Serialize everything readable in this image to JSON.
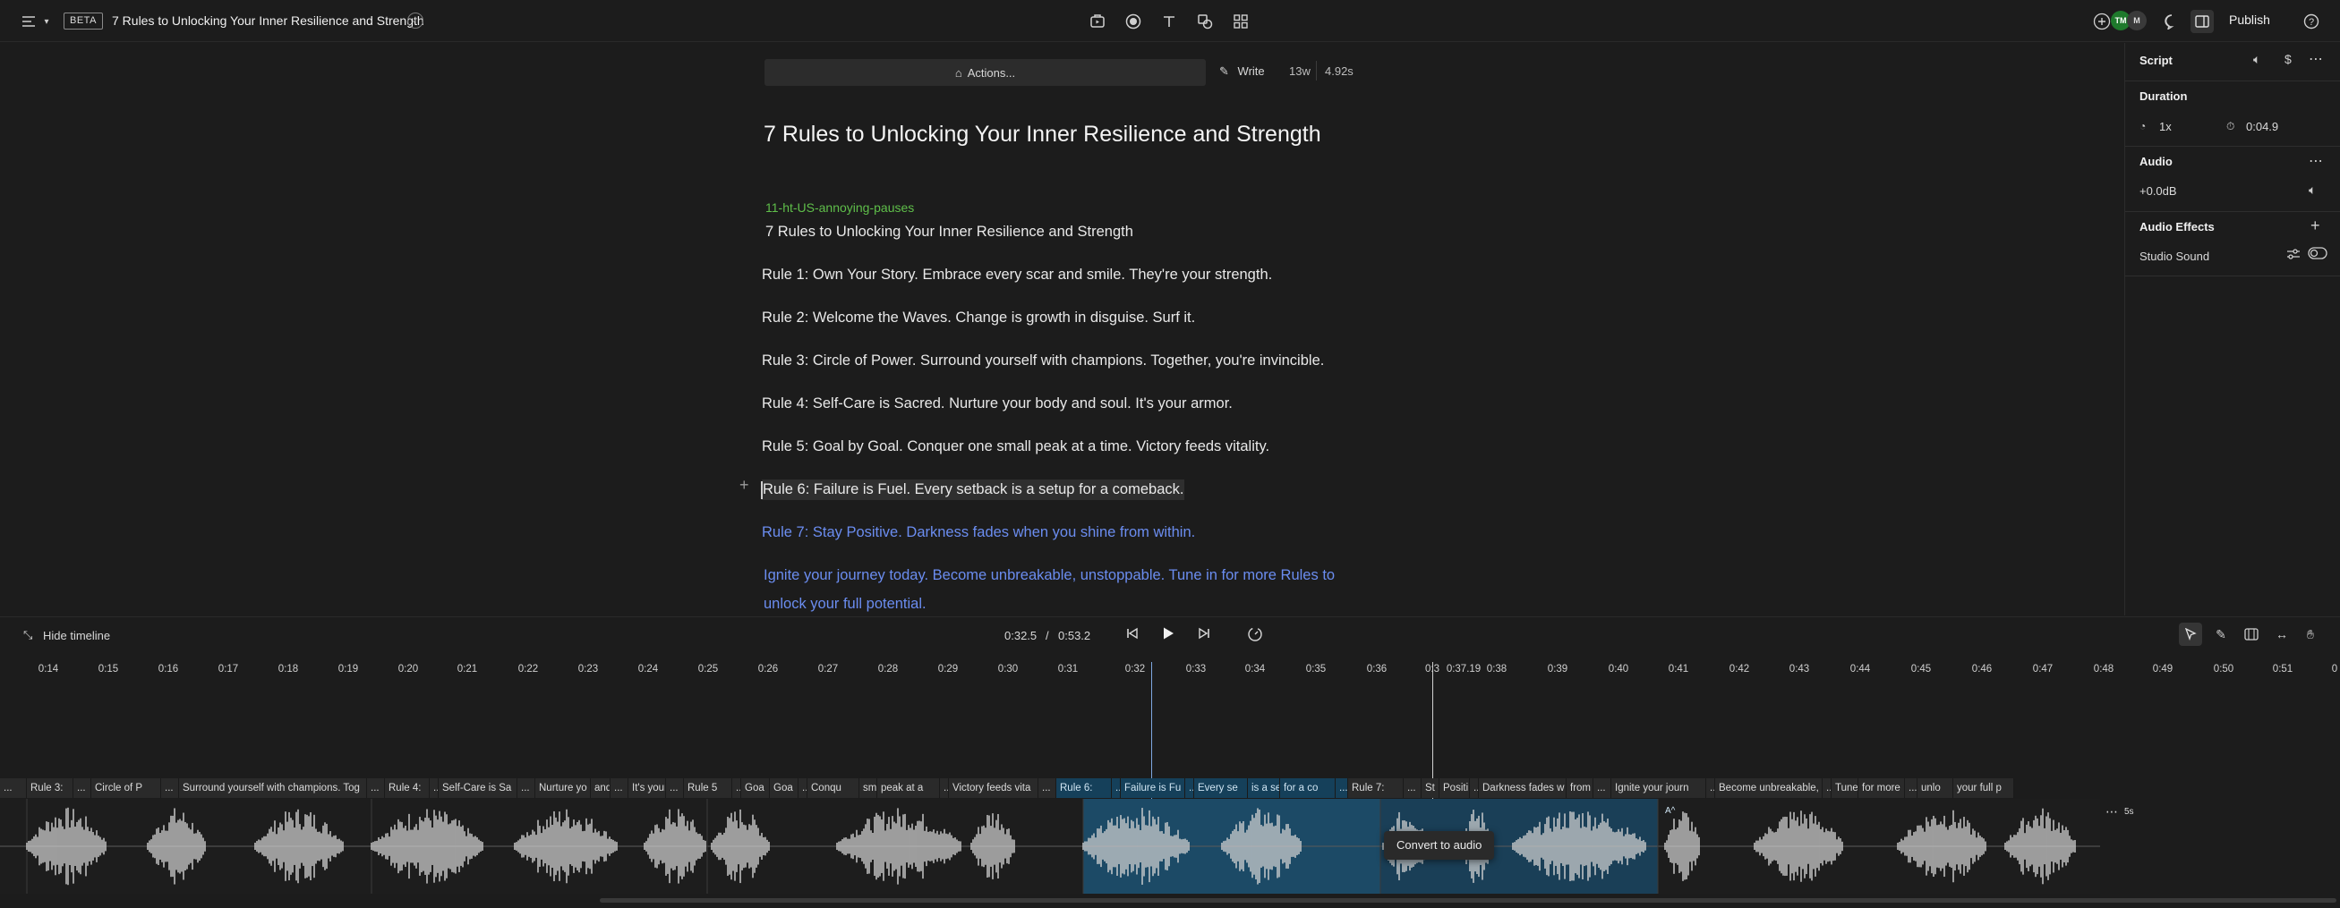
{
  "topbar": {
    "beta_label": "BETA",
    "doc_title": "7 Rules to Unlocking Your Inner Resilience and Strength",
    "publish_label": "Publish",
    "avatars": [
      "TM",
      "M"
    ]
  },
  "editor": {
    "actions_label": "Actions...",
    "write_label": "Write",
    "word_count": "13w",
    "duration": "4.92s",
    "heading": "7 Rules to Unlocking Your Inner Resilience and Strength",
    "speaker": "11-ht-US-annoying-pauses",
    "lines": [
      "7 Rules to Unlocking Your Inner Resilience and Strength",
      "Rule 1: Own Your Story. Embrace every scar and smile. They're your strength.",
      "Rule 2: Welcome the Waves. Change is growth in disguise. Surf it.",
      "Rule 3: Circle of Power. Surround yourself with champions. Together, you're invincible.",
      "Rule 4: Self-Care is Sacred. Nurture your body and soul. It's your armor.",
      "Rule 5: Goal by Goal. Conquer one small peak at a time. Victory feeds vitality.",
      "Rule 6: Failure is Fuel. Every setback is a setup for a comeback.",
      "Rule 7: Stay Positive. Darkness fades when you shine from within.",
      "Ignite your journey today. Become unbreakable, unstoppable. Tune in for more Rules to",
      "unlock your full potential."
    ]
  },
  "right_panel": {
    "script_title": "Script",
    "duration_title": "Duration",
    "speed": "1x",
    "clip_duration": "0:04.9",
    "audio_title": "Audio",
    "gain": "+0.0dB",
    "effects_title": "Audio Effects",
    "studio_sound": "Studio Sound"
  },
  "transport": {
    "hide_timeline": "Hide timeline",
    "current_time": "0:32.5",
    "separator": "/",
    "total_time": "0:53.2"
  },
  "ruler": {
    "ticks": [
      "0:14",
      "0:15",
      "0:16",
      "0:17",
      "0:18",
      "0:19",
      "0:20",
      "0:21",
      "0:22",
      "0:23",
      "0:24",
      "0:25",
      "0:26",
      "0:27",
      "0:28",
      "0:29",
      "0:30",
      "0:31",
      "0:32",
      "0:33",
      "0:34",
      "0:35",
      "0:36",
      "0:3",
      "0:37.19",
      "0:38",
      "0:39",
      "0:40",
      "0:41",
      "0:42",
      "0:43",
      "0:44",
      "0:45",
      "0:46",
      "0:47",
      "0:48",
      "0:49",
      "0:50",
      "0:51",
      "0"
    ]
  },
  "timeline": {
    "words": [
      {
        "t": "...",
        "hl": false
      },
      {
        "t": "Rule 3:",
        "hl": false
      },
      {
        "t": "...",
        "hl": false
      },
      {
        "t": "Circle of P",
        "hl": false
      },
      {
        "t": "...",
        "hl": false
      },
      {
        "t": "Surround yourself with champions. Tog",
        "hl": false
      },
      {
        "t": "...",
        "hl": false
      },
      {
        "t": "Rule 4:",
        "hl": false
      },
      {
        "t": "...",
        "hl": false
      },
      {
        "t": "Self-Care is Sa",
        "hl": false
      },
      {
        "t": "...",
        "hl": false
      },
      {
        "t": "Nurture yo",
        "hl": false
      },
      {
        "t": "and s",
        "hl": false
      },
      {
        "t": "...",
        "hl": false
      },
      {
        "t": "It's your",
        "hl": false
      },
      {
        "t": "...",
        "hl": false
      },
      {
        "t": "Rule 5",
        "hl": false
      },
      {
        "t": "...",
        "hl": false
      },
      {
        "t": "Goa",
        "hl": false
      },
      {
        "t": "Goa",
        "hl": false
      },
      {
        "t": "...",
        "hl": false
      },
      {
        "t": "Conqu",
        "hl": false
      },
      {
        "t": "sma",
        "hl": false
      },
      {
        "t": "peak at a",
        "hl": false
      },
      {
        "t": "...",
        "hl": false
      },
      {
        "t": "Victory feeds vita",
        "hl": false
      },
      {
        "t": "...",
        "hl": false
      },
      {
        "t": "Rule 6:",
        "hl": true
      },
      {
        "t": "...",
        "hl": true
      },
      {
        "t": "Failure is Fu",
        "hl": true
      },
      {
        "t": "...",
        "hl": true
      },
      {
        "t": "Every se",
        "hl": true
      },
      {
        "t": "is a se",
        "hl": true
      },
      {
        "t": "for a co",
        "hl": true
      },
      {
        "t": "...",
        "hl": true
      },
      {
        "t": "Rule 7:",
        "hl": false
      },
      {
        "t": "...",
        "hl": false
      },
      {
        "t": "St",
        "hl": false
      },
      {
        "t": "Positi",
        "hl": false
      },
      {
        "t": "...",
        "hl": false
      },
      {
        "t": "Darkness fades w",
        "hl": false
      },
      {
        "t": "from w",
        "hl": false
      },
      {
        "t": "...",
        "hl": false
      },
      {
        "t": "Ignite your journ",
        "hl": false
      },
      {
        "t": "...",
        "hl": false
      },
      {
        "t": "Become unbreakable, u",
        "hl": false
      },
      {
        "t": "...",
        "hl": false
      },
      {
        "t": "Tune",
        "hl": false
      },
      {
        "t": "for more",
        "hl": false
      },
      {
        "t": "...",
        "hl": false
      },
      {
        "t": "unlo",
        "hl": false
      },
      {
        "t": "your full p",
        "hl": false
      }
    ],
    "tooltip": "Convert to audio",
    "end_badge": "5s",
    "caret_badge": "A^"
  },
  "colors": {
    "background": "#1c1c1c",
    "speaker_green": "#5fbf4a",
    "unplayed_blue": "#6b8df0",
    "selection_blue": "#15405a",
    "playhead": "#7fa8e0"
  }
}
